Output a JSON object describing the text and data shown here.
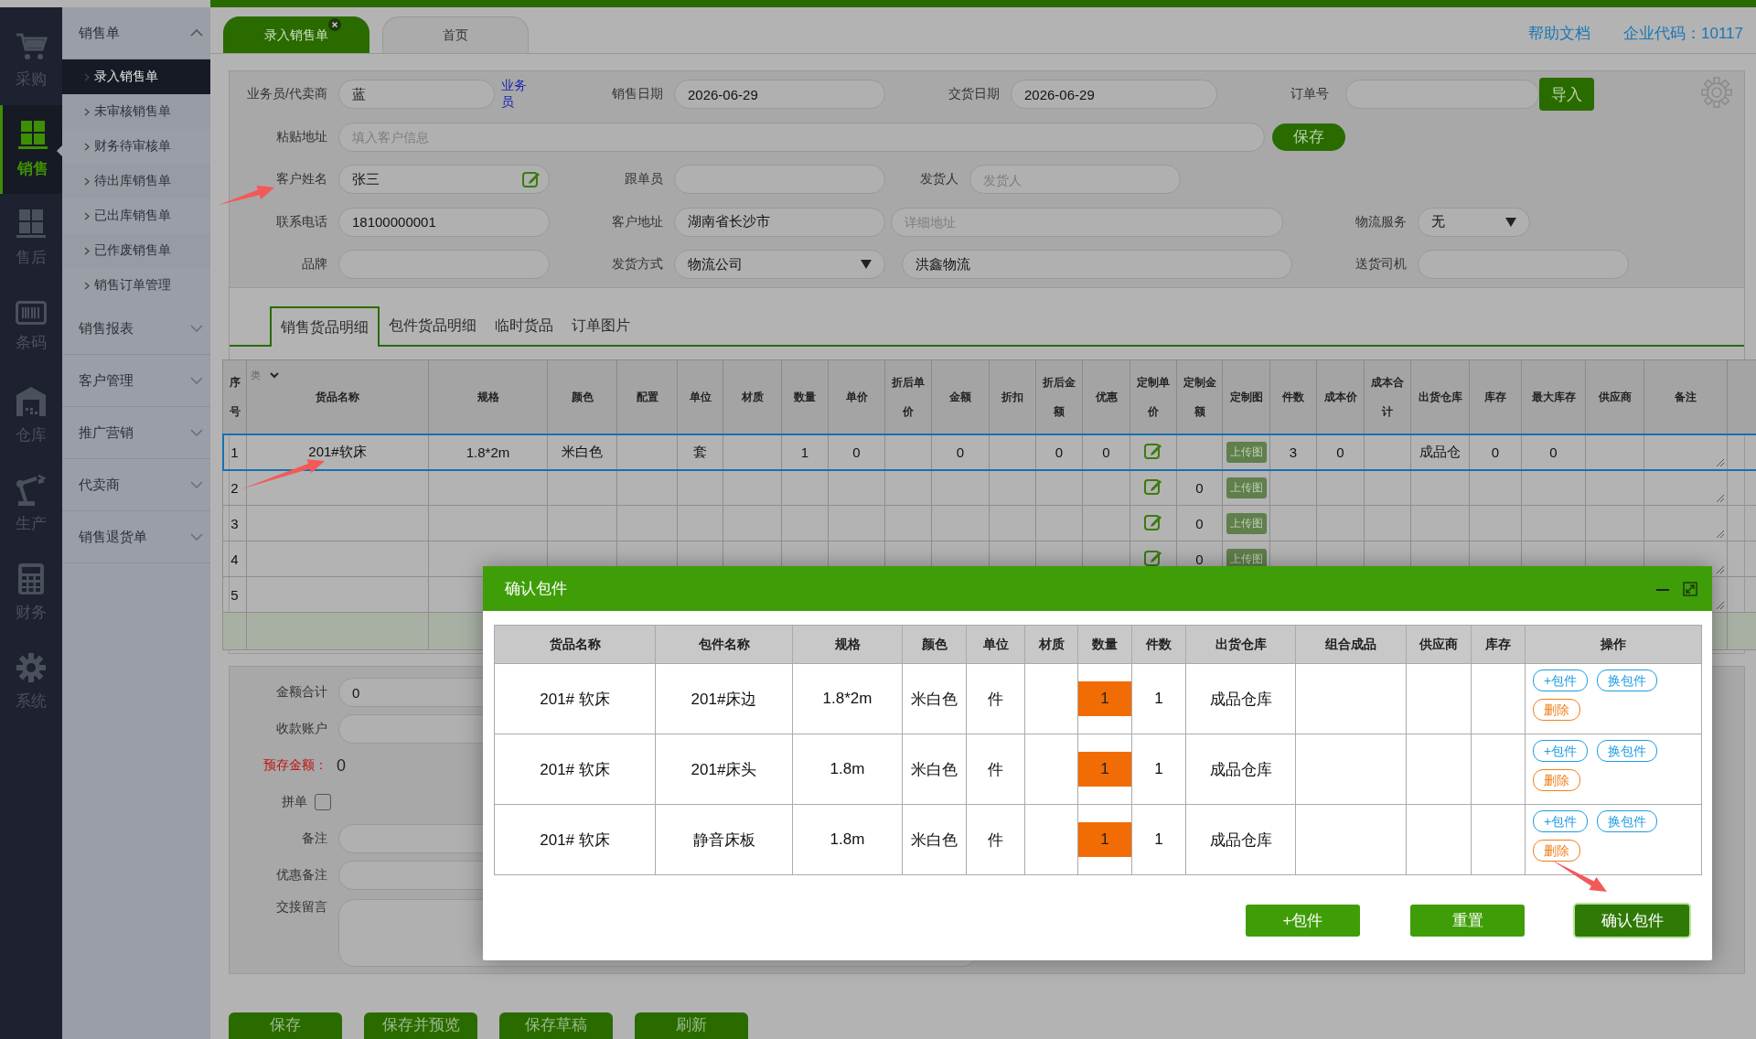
{
  "rail": [
    {
      "label": "采购",
      "kind": "cart",
      "selected": false
    },
    {
      "label": "销售",
      "kind": "pallet",
      "selected": true
    },
    {
      "label": "售后",
      "kind": "pallet",
      "selected": false
    },
    {
      "label": "条码",
      "kind": "barcode",
      "selected": false
    },
    {
      "label": "仓库",
      "kind": "warehouse",
      "selected": false
    },
    {
      "label": "生产",
      "kind": "robot",
      "selected": false
    },
    {
      "label": "财务",
      "kind": "calculator",
      "selected": false
    },
    {
      "label": "系统",
      "kind": "gear",
      "selected": false
    }
  ],
  "submenu": [
    {
      "label": "销售单",
      "expanded": true,
      "children": [
        {
          "label": "录入销售单",
          "selected": true
        },
        {
          "label": "未审核销售单",
          "selected": false
        },
        {
          "label": "财务待审核单",
          "selected": false
        },
        {
          "label": "待出库销售单",
          "selected": false
        },
        {
          "label": "已出库销售单",
          "selected": false
        },
        {
          "label": "已作废销售单",
          "selected": false
        },
        {
          "label": "销售订单管理",
          "selected": false
        }
      ]
    },
    {
      "label": "销售报表",
      "expanded": false
    },
    {
      "label": "客户管理",
      "expanded": false
    },
    {
      "label": "推广营销",
      "expanded": false
    },
    {
      "label": "代卖商",
      "expanded": false
    },
    {
      "label": "销售退货单",
      "expanded": false
    }
  ],
  "tabs": [
    {
      "label": "录入销售单",
      "selected": true,
      "closable": true
    },
    {
      "label": "首页",
      "selected": false,
      "closable": false
    }
  ],
  "header_links": [
    "帮助文档",
    "企业代码：10117"
  ],
  "form": {
    "salesperson": {
      "label": "业务员/代卖商",
      "value": "蓝",
      "link": "业务员"
    },
    "sale_date": {
      "label": "销售日期",
      "value": "2026-06-29"
    },
    "delivery_date": {
      "label": "交货日期",
      "value": "2026-06-29"
    },
    "order_no": {
      "label": "订单号",
      "button": "导入"
    },
    "paste_address": {
      "label": "粘贴地址",
      "placeholder": "填入客户信息",
      "button": "保存"
    },
    "customer_name": {
      "label": "客户姓名",
      "value": "张三"
    },
    "follower": {
      "label": "跟单员"
    },
    "shipper": {
      "label": "发货人",
      "placeholder": "发货人"
    },
    "phone": {
      "label": "联系电话",
      "value": "18100000001"
    },
    "customer_address": {
      "label": "客户地址",
      "value": "湖南省长沙市",
      "detail_placeholder": "详细地址"
    },
    "logistics_service": {
      "label": "物流服务",
      "value": "无"
    },
    "brand": {
      "label": "品牌"
    },
    "ship_method": {
      "label": "发货方式",
      "value": "物流公司",
      "carrier": "洪鑫物流"
    },
    "driver": {
      "label": "送货司机"
    }
  },
  "sub_tabs": [
    {
      "label": "销售货品明细",
      "selected": true
    },
    {
      "label": "包件货品明细",
      "selected": false
    },
    {
      "label": "临时货品",
      "selected": false
    },
    {
      "label": "订单图片",
      "selected": false
    }
  ],
  "table": {
    "columns": [
      {
        "label": "序号"
      },
      {
        "label": "货品名称",
        "filter": "类"
      },
      {
        "label": "规格"
      },
      {
        "label": "颜色"
      },
      {
        "label": "配置"
      },
      {
        "label": "单位"
      },
      {
        "label": "材质"
      },
      {
        "label": "数量"
      },
      {
        "label": "单价"
      },
      {
        "label": "折后单价"
      },
      {
        "label": "金额"
      },
      {
        "label": "折扣"
      },
      {
        "label": "折后金额"
      },
      {
        "label": "优惠"
      },
      {
        "label": "定制单价"
      },
      {
        "label": "定制金额"
      },
      {
        "label": "定制图"
      },
      {
        "label": "件数"
      },
      {
        "label": "成本价"
      },
      {
        "label": "成本合计"
      },
      {
        "label": "出货仓库"
      },
      {
        "label": "库存"
      },
      {
        "label": "最大库存"
      },
      {
        "label": "供应商"
      },
      {
        "label": "备注"
      }
    ],
    "rows": [
      {
        "no": "1",
        "name": "201#软床",
        "spec": "1.8*2m",
        "color_name": "米白色",
        "unit": "套",
        "qty": "1",
        "price": "0",
        "amount": "0",
        "disc_amount": "0",
        "promo": "0",
        "custom_image": "上传图",
        "pieces": "3",
        "cost": "0",
        "warehouse": "成品仓",
        "stock": "0",
        "max_stock": "0",
        "selected": true
      },
      {
        "no": "2",
        "custom_amount": "0",
        "custom_image": "上传图",
        "selected": false
      },
      {
        "no": "3",
        "custom_amount": "0",
        "custom_image": "上传图",
        "selected": false
      },
      {
        "no": "4",
        "custom_amount": "0",
        "custom_image": "上传图",
        "selected": false
      },
      {
        "no": "5",
        "selected": false
      }
    ]
  },
  "summary": {
    "total": {
      "label": "金额合计",
      "value": "0"
    },
    "account": {
      "label": "收款账户"
    },
    "prepaid": {
      "label": "预存金额：",
      "value": "0"
    },
    "combine": {
      "label": "拼单",
      "checked": false
    },
    "remark": {
      "label": "备注"
    },
    "promo_remark": {
      "label": "优惠备注"
    },
    "handover": {
      "label": "交接留言"
    }
  },
  "bottom_buttons": [
    "保存",
    "保存并预览",
    "保存草稿",
    "刷新"
  ],
  "modal": {
    "title": "确认包件",
    "columns": [
      "货品名称",
      "包件名称",
      "规格",
      "颜色",
      "单位",
      "材质",
      "数量",
      "件数",
      "出货仓库",
      "组合成品",
      "供应商",
      "库存",
      "操作"
    ],
    "rows": [
      {
        "product": "201# 软床",
        "part": "201#床边",
        "spec": "1.8*2m",
        "color_name": "米白色",
        "unit": "件",
        "qty": "1",
        "pieces": "1",
        "warehouse": "成品仓库",
        "actions": [
          {
            "label": "+包件",
            "kind": "add"
          },
          {
            "label": "换包件",
            "kind": "swap"
          },
          {
            "label": "删除",
            "kind": "delete"
          }
        ]
      },
      {
        "product": "201# 软床",
        "part": "201#床头",
        "spec": "1.8m",
        "color_name": "米白色",
        "unit": "件",
        "qty": "1",
        "pieces": "1",
        "warehouse": "成品仓库",
        "actions": [
          {
            "label": "+包件",
            "kind": "add"
          },
          {
            "label": "换包件",
            "kind": "swap"
          },
          {
            "label": "删除",
            "kind": "delete"
          }
        ]
      },
      {
        "product": "201# 软床",
        "part": "静音床板",
        "spec": "1.8m",
        "color_name": "米白色",
        "unit": "件",
        "qty": "1",
        "pieces": "1",
        "warehouse": "成品仓库",
        "actions": [
          {
            "label": "+包件",
            "kind": "add"
          },
          {
            "label": "换包件",
            "kind": "swap"
          },
          {
            "label": "删除",
            "kind": "delete"
          }
        ]
      }
    ],
    "buttons": [
      {
        "label": "+包件",
        "focused": false
      },
      {
        "label": "重置",
        "focused": false
      },
      {
        "label": "确认包件",
        "focused": true
      }
    ]
  }
}
